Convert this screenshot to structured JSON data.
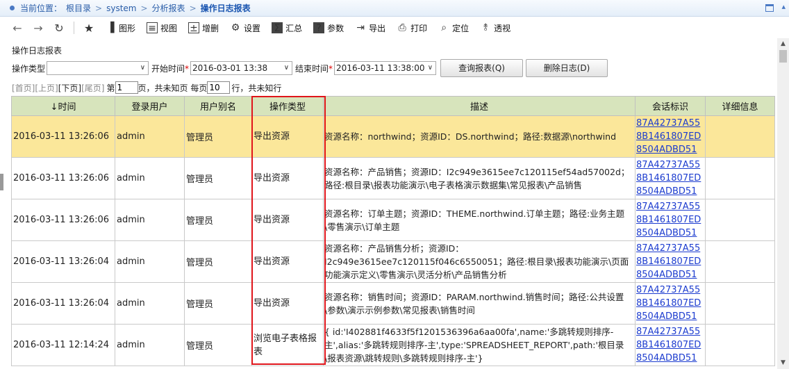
{
  "breadcrumb": {
    "prefix": "当前位置：",
    "items": [
      "根目录",
      "system",
      "分析报表"
    ],
    "current": "操作日志报表",
    "separator": ">"
  },
  "toolbar": {
    "buttons": [
      {
        "label": "图形",
        "icon": "chart-icon"
      },
      {
        "label": "视图",
        "icon": "view-icon"
      },
      {
        "label": "增删",
        "icon": "add-delete-icon"
      },
      {
        "label": "设置",
        "icon": "gear-icon"
      },
      {
        "label": "汇总",
        "icon": "sum-icon"
      },
      {
        "label": "参数",
        "icon": "question-icon"
      },
      {
        "label": "导出",
        "icon": "export-icon"
      },
      {
        "label": "打印",
        "icon": "print-icon"
      },
      {
        "label": "定位",
        "icon": "locate-icon"
      },
      {
        "label": "透视",
        "icon": "pivot-icon"
      }
    ]
  },
  "report": {
    "title": "操作日志报表"
  },
  "filters": {
    "op_type_label": "操作类型",
    "op_type_value": "",
    "start_label": "开始时间",
    "start_value": "2016-03-01 13:38",
    "end_label": "结束时间",
    "end_value": "2016-03-11 13:38:00",
    "required_mark": "*",
    "query_button": "查询报表(Q)",
    "delete_button": "删除日志(D)"
  },
  "pager": {
    "first": "[首页]",
    "prev": "[上页]",
    "next": "[下页]",
    "last": "[尾页]",
    "page_prefix": "第",
    "page_value": "1",
    "page_suffix": "页，共未知页 每页",
    "rows_value": "10",
    "rows_suffix": "行，共未知行"
  },
  "table": {
    "columns": [
      "↓时间",
      "登录用户",
      "用户别名",
      "操作类型",
      "描述",
      "会话标识",
      "详细信息"
    ],
    "rows": [
      {
        "time": "2016-03-11 13:26:06",
        "user": "admin",
        "alias": "管理员",
        "optype": "导出资源",
        "desc": "资源名称：northwind；资源ID：DS.northwind；路径:数据源\\northwind",
        "session": "87A42737A558B1461807ED8504ADBD51",
        "detail": "",
        "selected": true
      },
      {
        "time": "2016-03-11 13:26:06",
        "user": "admin",
        "alias": "管理员",
        "optype": "导出资源",
        "desc": "资源名称：产品销售；资源ID：I2c949e3615ee7c120115ef54ad57002d；路径:根目录\\报表功能演示\\电子表格演示数据集\\常见报表\\产品销售",
        "session": "87A42737A558B1461807ED8504ADBD51",
        "detail": "",
        "selected": false
      },
      {
        "time": "2016-03-11 13:26:06",
        "user": "admin",
        "alias": "管理员",
        "optype": "导出资源",
        "desc": "资源名称：订单主题；资源ID：THEME.northwind.订单主题；路径:业务主题\\零售演示\\订单主题",
        "session": "87A42737A558B1461807ED8504ADBD51",
        "detail": "",
        "selected": false
      },
      {
        "time": "2016-03-11 13:26:04",
        "user": "admin",
        "alias": "管理员",
        "optype": "导出资源",
        "desc": "资源名称：产品销售分析；资源ID：I2c949e3615ee7c120115f046c6550051；路径:根目录\\报表功能演示\\页面功能演示定义\\零售演示\\灵活分析\\产品销售分析",
        "session": "87A42737A558B1461807ED8504ADBD51",
        "detail": "",
        "selected": false
      },
      {
        "time": "2016-03-11 13:26:04",
        "user": "admin",
        "alias": "管理员",
        "optype": "导出资源",
        "desc": "资源名称：销售时间；资源ID：PARAM.northwind.销售时间；路径:公共设置\\参数\\演示示例参数\\常见报表\\销售时间",
        "session": "87A42737A558B1461807ED8504ADBD51",
        "detail": "",
        "selected": false
      },
      {
        "time": "2016-03-11 12:14:24",
        "user": "admin",
        "alias": "管理员",
        "optype": "浏览电子表格报表",
        "desc": "{ id:'I402881f4633f5f1201536396a6aa00fa',name:'多跳转规则排序-主',alias:'多跳转规则排序-主',type:'SPREADSHEET_REPORT',path:'根目录\\报表资源\\跳转规则\\多跳转规则排序-主'}",
        "session": "87A42737A558B1461807ED8504ADBD51",
        "detail": "",
        "selected": false
      }
    ]
  },
  "colors": {
    "header_bg": "#d7e4bc",
    "selected_row_bg": "#fbe79a",
    "highlight_border": "#e0151b",
    "link": "#1c3ccf"
  }
}
